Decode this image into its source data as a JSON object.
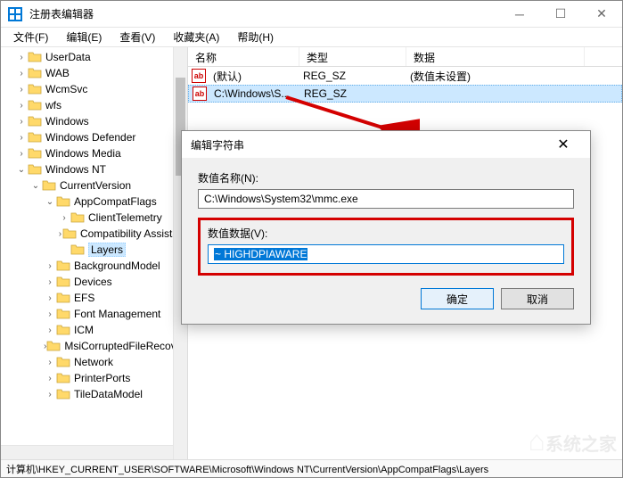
{
  "window": {
    "title": "注册表编辑器"
  },
  "menubar": {
    "items": [
      "文件(F)",
      "编辑(E)",
      "查看(V)",
      "收藏夹(A)",
      "帮助(H)"
    ]
  },
  "tree": {
    "nodes": [
      {
        "indent": 1,
        "expand": ">",
        "label": "UserData"
      },
      {
        "indent": 1,
        "expand": ">",
        "label": "WAB"
      },
      {
        "indent": 1,
        "expand": ">",
        "label": "WcmSvc"
      },
      {
        "indent": 1,
        "expand": ">",
        "label": "wfs"
      },
      {
        "indent": 1,
        "expand": ">",
        "label": "Windows"
      },
      {
        "indent": 1,
        "expand": ">",
        "label": "Windows Defender"
      },
      {
        "indent": 1,
        "expand": ">",
        "label": "Windows Media"
      },
      {
        "indent": 1,
        "expand": "v",
        "label": "Windows NT"
      },
      {
        "indent": 2,
        "expand": "v",
        "label": "CurrentVersion"
      },
      {
        "indent": 3,
        "expand": "v",
        "label": "AppCompatFlags"
      },
      {
        "indent": 4,
        "expand": ">",
        "label": "ClientTelemetry"
      },
      {
        "indent": 4,
        "expand": ">",
        "label": "Compatibility Assistant"
      },
      {
        "indent": 4,
        "expand": "",
        "label": "Layers",
        "selected": true
      },
      {
        "indent": 3,
        "expand": ">",
        "label": "BackgroundModel"
      },
      {
        "indent": 3,
        "expand": ">",
        "label": "Devices"
      },
      {
        "indent": 3,
        "expand": ">",
        "label": "EFS"
      },
      {
        "indent": 3,
        "expand": ">",
        "label": "Font Management"
      },
      {
        "indent": 3,
        "expand": ">",
        "label": "ICM"
      },
      {
        "indent": 3,
        "expand": ">",
        "label": "MsiCorruptedFileRecovery"
      },
      {
        "indent": 3,
        "expand": ">",
        "label": "Network"
      },
      {
        "indent": 3,
        "expand": ">",
        "label": "PrinterPorts"
      },
      {
        "indent": 3,
        "expand": ">",
        "label": "TileDataModel"
      }
    ]
  },
  "list": {
    "columns": {
      "name": "名称",
      "type": "类型",
      "data": "数据"
    },
    "col_widths": {
      "name": 125,
      "type": 120,
      "data": 200
    },
    "rows": [
      {
        "name": "(默认)",
        "type": "REG_SZ",
        "data": "(数值未设置)",
        "selected": false
      },
      {
        "name": "C:\\Windows\\S...",
        "type": "REG_SZ",
        "data": "",
        "selected": true
      }
    ]
  },
  "dialog": {
    "title": "编辑字符串",
    "name_label": "数值名称(N):",
    "name_value": "C:\\Windows\\System32\\mmc.exe",
    "data_label": "数值数据(V):",
    "data_value": "~ HIGHDPIAWARE",
    "ok": "确定",
    "cancel": "取消"
  },
  "statusbar": {
    "path": "计算机\\HKEY_CURRENT_USER\\SOFTWARE\\Microsoft\\Windows NT\\CurrentVersion\\AppCompatFlags\\Layers"
  },
  "watermark": {
    "text": "系统之家"
  }
}
